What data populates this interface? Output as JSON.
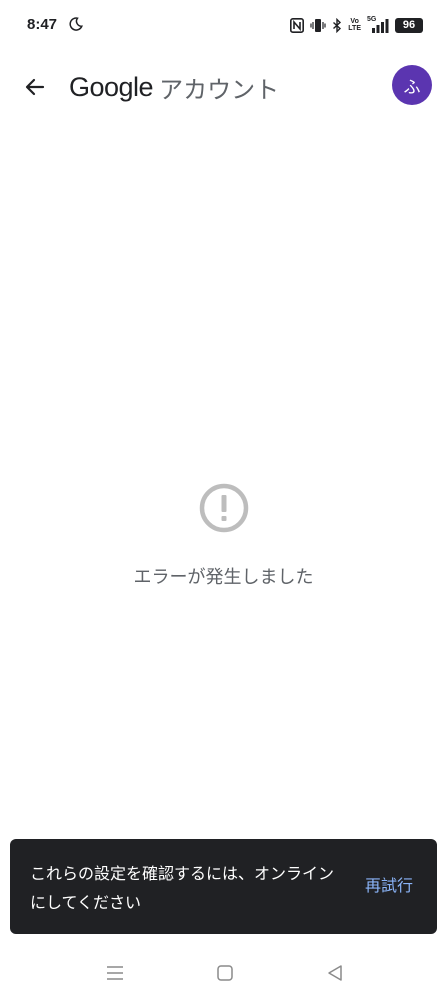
{
  "status_bar": {
    "time": "8:47",
    "network": "5G",
    "volte_top": "Vo",
    "volte_bottom": "LTE",
    "battery": "96"
  },
  "app_bar": {
    "brand": "Google",
    "title": "アカウント",
    "avatar_letter": "ふ"
  },
  "error": {
    "message": "エラーが発生しました"
  },
  "snackbar": {
    "message": "これらの設定を確認するには、オンラインにしてください",
    "action": "再試行"
  },
  "colors": {
    "avatar": "#5b35b0",
    "snackbar_bg": "#202124",
    "snackbar_action": "#8ab4f8",
    "error_icon": "#bdbdbd"
  }
}
